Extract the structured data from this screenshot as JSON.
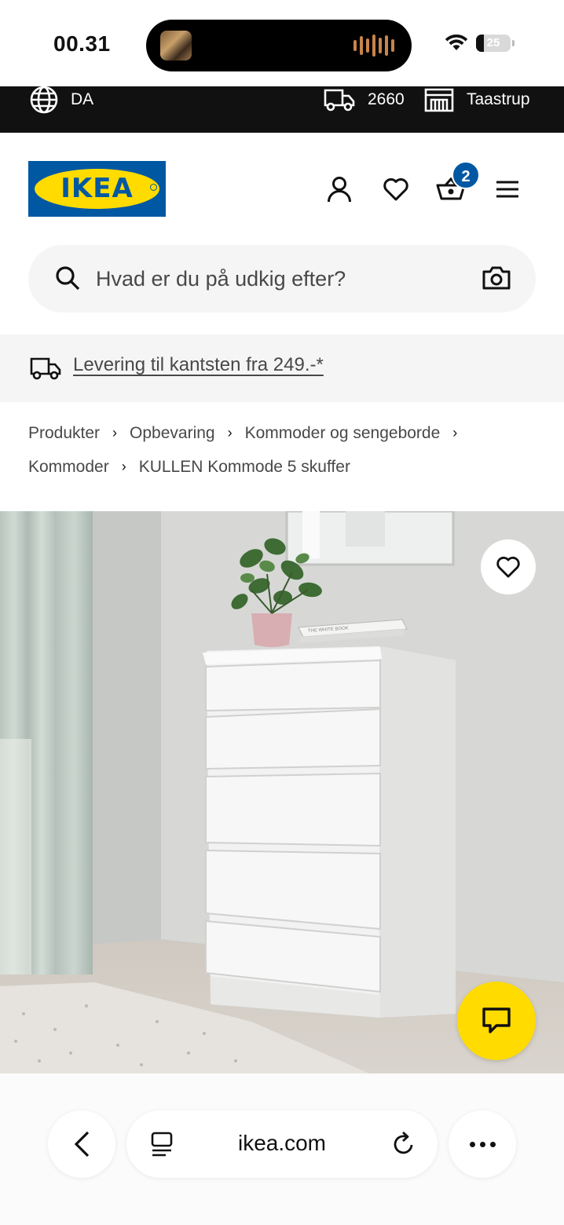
{
  "status_bar": {
    "time": "00.31",
    "battery": "25"
  },
  "topbar": {
    "language": "DA",
    "postcode": "2660",
    "store": "Taastrup"
  },
  "header": {
    "logo_text": "IKEA",
    "cart_count": "2"
  },
  "search": {
    "placeholder": "Hvad er du på udkig efter?"
  },
  "delivery": {
    "text": "Levering til kantsten fra 249.-*"
  },
  "breadcrumb": {
    "items": [
      "Produkter",
      "Opbevaring",
      "Kommoder og sengeborde",
      "Kommoder",
      "KULLEN Kommode 5 skuffer"
    ]
  },
  "product_image": {
    "book_text": "THE WHITE BOOK"
  },
  "browser": {
    "url": "ikea.com"
  },
  "colors": {
    "ikea_blue": "#0058a3",
    "ikea_yellow": "#ffdb00",
    "topbar": "#111111"
  },
  "icons": [
    "globe-icon",
    "truck-icon",
    "store-icon",
    "user-icon",
    "heart-icon",
    "basket-icon",
    "menu-icon",
    "search-icon",
    "camera-icon",
    "chat-icon",
    "chevron-left-icon",
    "tabs-icon",
    "reload-icon",
    "more-icon"
  ]
}
